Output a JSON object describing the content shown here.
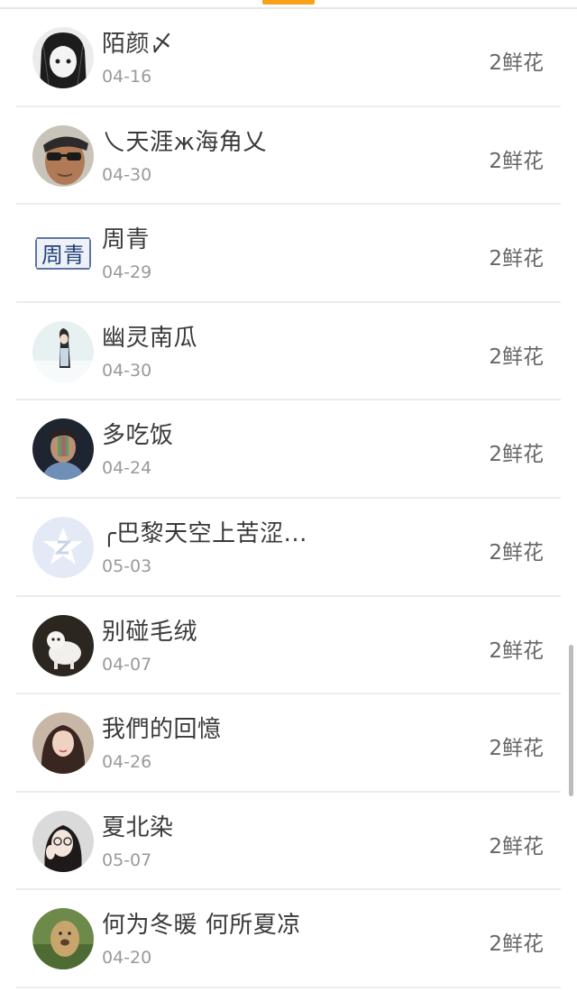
{
  "tab_indicator_color": "#f7a21a",
  "rows": [
    {
      "name": "陌颜〆",
      "date": "04-16",
      "flowers": "2鲜花",
      "avatar": "anime-girl-avatar"
    },
    {
      "name": "乀天涯ж海角乂",
      "date": "04-30",
      "flowers": "2鲜花",
      "avatar": "man-sunglasses-avatar"
    },
    {
      "name": "周青",
      "date": "04-29",
      "flowers": "2鲜花",
      "avatar": "zhouqing-text-avatar",
      "avatar_text": "周青"
    },
    {
      "name": "幽灵南瓜",
      "date": "04-30",
      "flowers": "2鲜花",
      "avatar": "girl-snow-avatar"
    },
    {
      "name": "多吃饭",
      "date": "04-24",
      "flowers": "2鲜花",
      "avatar": "boy-portrait-avatar"
    },
    {
      "name": "╭巴黎天空上苦涩...",
      "date": "05-03",
      "flowers": "2鲜花",
      "avatar": "default-star-avatar"
    },
    {
      "name": "别碰毛绒",
      "date": "04-07",
      "flowers": "2鲜花",
      "avatar": "white-dog-avatar"
    },
    {
      "name": "我們的回憶",
      "date": "04-26",
      "flowers": "2鲜花",
      "avatar": "woman-portrait-avatar"
    },
    {
      "name": "夏北染",
      "date": "05-07",
      "flowers": "2鲜花",
      "avatar": "girl-selfie-avatar"
    },
    {
      "name": "何为冬暖 何所夏凉",
      "date": "04-20",
      "flowers": "2鲜花",
      "avatar": "dog-outdoor-avatar"
    }
  ]
}
